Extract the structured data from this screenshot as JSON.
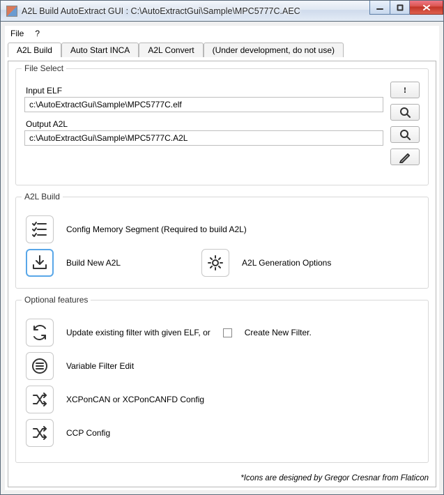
{
  "window": {
    "title": "A2L Build AutoExtract GUI : C:\\AutoExtractGui\\Sample\\MPC5777C.AEC"
  },
  "menubar": {
    "file": "File",
    "help": "?"
  },
  "tabs": {
    "t0": "A2L Build",
    "t1": "Auto Start INCA",
    "t2": "A2L Convert",
    "t3": "(Under development, do not use)"
  },
  "file_select": {
    "legend": "File Select",
    "input_elf_label": "Input ELF",
    "input_elf_value": "c:\\AutoExtractGui\\Sample\\MPC5777C.elf",
    "output_a2l_label": "Output A2L",
    "output_a2l_value": "c:\\AutoExtractGui\\Sample\\MPC5777C.A2L",
    "exclaim": "!"
  },
  "a2l_build": {
    "legend": "A2L Build",
    "config_mem": "Config Memory Segment (Required to build A2L)",
    "build_new": "Build New A2L",
    "gen_opts": "A2L Generation Options"
  },
  "optional": {
    "legend": "Optional features",
    "update_filter_pre": "Update existing filter with given ELF, or",
    "create_new_filter": "Create New Filter.",
    "var_filter_edit": "Variable Filter Edit",
    "xcp_config": "XCPonCAN or XCPonCANFD Config",
    "ccp_config": "CCP Config"
  },
  "footer": "*Icons are designed by Gregor Cresnar from Flaticon"
}
